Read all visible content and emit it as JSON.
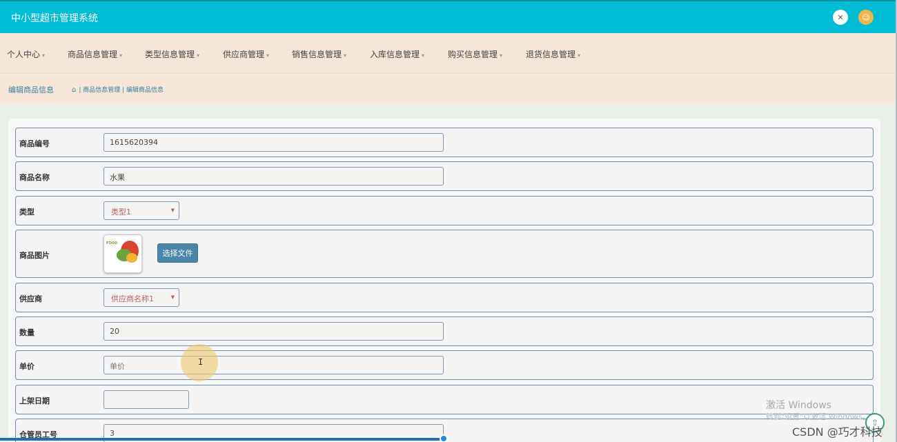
{
  "app": {
    "title": "中小型超市管理系统"
  },
  "header": {
    "fullscreen_icon": "expand-icon",
    "user_icon": "user-avatar-icon"
  },
  "nav": {
    "items": [
      {
        "label": "个人中心"
      },
      {
        "label": "商品信息管理"
      },
      {
        "label": "类型信息管理"
      },
      {
        "label": "供应商管理"
      },
      {
        "label": "销售信息管理"
      },
      {
        "label": "入库信息管理"
      },
      {
        "label": "购买信息管理"
      },
      {
        "label": "退货信息管理"
      }
    ],
    "caret": "▾"
  },
  "breadcrumb": {
    "page_title": "编辑商品信息",
    "home_icon": "⌂",
    "path": "| 商品信息管理 | 编辑商品信息"
  },
  "form": {
    "goods_no": {
      "label": "商品编号",
      "value": "1615620394"
    },
    "goods_name": {
      "label": "商品名称",
      "value": "水果"
    },
    "type": {
      "label": "类型",
      "selected": "类型1"
    },
    "image": {
      "label": "商品图片",
      "thumb_text": "FOOD",
      "button": "选择文件"
    },
    "supplier": {
      "label": "供应商",
      "selected": "供应商名称1"
    },
    "quantity": {
      "label": "数量",
      "value": "20"
    },
    "price": {
      "label": "单价",
      "placeholder": "单价"
    },
    "shelf_date": {
      "label": "上架日期",
      "value": ""
    },
    "keeper_no": {
      "label": "仓管员工号",
      "value": "3"
    }
  },
  "overlay": {
    "watermark_title": "激活 Windows",
    "watermark_sub": "转到\"设置\"以激活 Windows。",
    "csdn": "CSDN @巧才科技",
    "cursor": "I",
    "up_icon": "⇧"
  },
  "colors": {
    "topbar": "#00bcd4",
    "navbar": "#f5e6d8",
    "accent_blue": "#4a86a8"
  }
}
